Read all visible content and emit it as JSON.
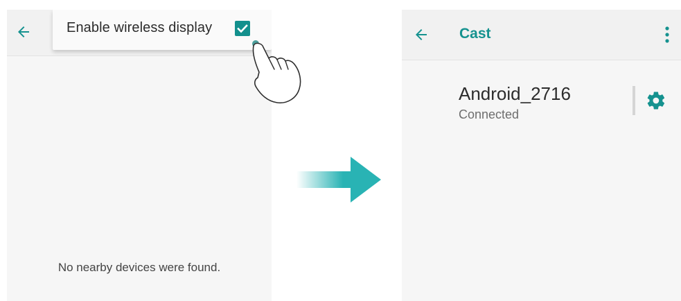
{
  "left_screen": {
    "back_icon": "arrow-left-icon",
    "menu": {
      "item_label": "Enable wireless display",
      "checked": true
    },
    "empty_message": "No nearby devices were found."
  },
  "right_screen": {
    "back_icon": "arrow-left-icon",
    "title": "Cast",
    "overflow_icon": "more-vert-icon",
    "device": {
      "name": "Android_2716",
      "status": "Connected",
      "settings_icon": "gear-icon"
    }
  },
  "colors": {
    "accent": "#13908d",
    "arrow": "#29b3b4"
  }
}
